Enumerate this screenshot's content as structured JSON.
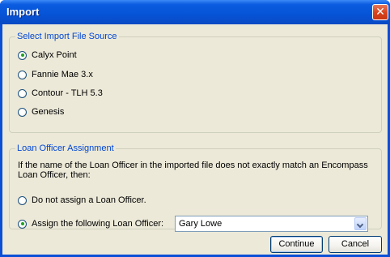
{
  "window": {
    "title": "Import",
    "close_label": "✕"
  },
  "source_group": {
    "legend": "Select Import File Source",
    "options": [
      {
        "label": "Calyx Point",
        "checked": true
      },
      {
        "label": "Fannie Mae 3.x",
        "checked": false
      },
      {
        "label": "Contour - TLH 5.3",
        "checked": false
      },
      {
        "label": "Genesis",
        "checked": false
      }
    ]
  },
  "officer_group": {
    "legend": "Loan Officer Assignment",
    "description": "If the name of the Loan Officer in the imported file does not exactly match an Encompass Loan Officer, then:",
    "options": [
      {
        "label": "Do not assign a Loan Officer.",
        "checked": false
      },
      {
        "label": "Assign the following Loan Officer:",
        "checked": true
      }
    ],
    "selected_officer": "Gary Lowe"
  },
  "buttons": {
    "continue_label": "Continue",
    "cancel_label": "Cancel"
  },
  "colors": {
    "title_bar": "#0653d6",
    "dialog_background": "#ece9d8",
    "group_legend_text": "#0046d5",
    "close_button": "#d8451f"
  }
}
